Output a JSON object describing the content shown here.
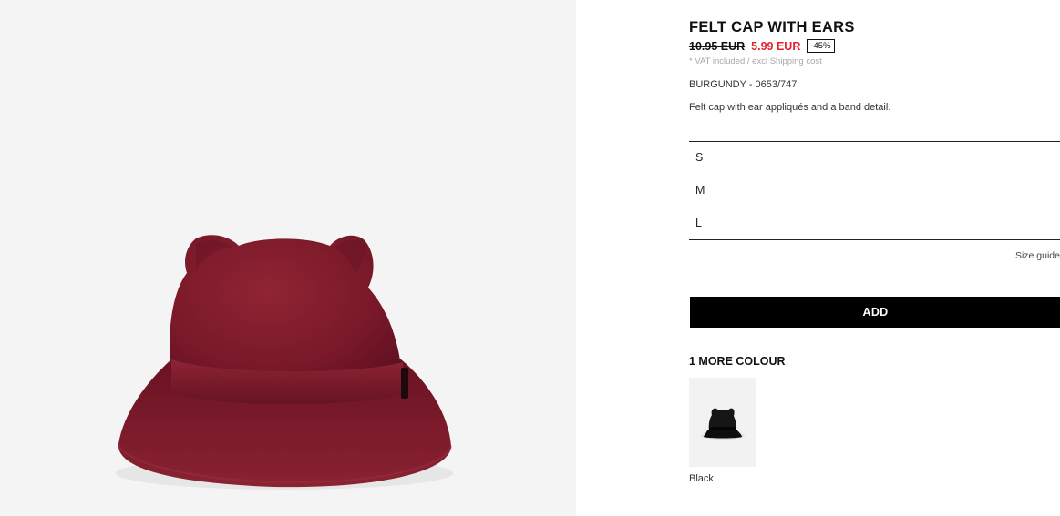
{
  "product": {
    "title": "FELT CAP WITH EARS",
    "old_price": "10.95 EUR",
    "new_price": "5.99 EUR",
    "discount": "-45%",
    "vat_note": "* VAT included / excl Shipping cost",
    "colour_code": "BURGUNDY - 0653/747",
    "description": "Felt cap with ear appliqués and a band detail.",
    "image_colour": "#7e1a2a"
  },
  "sizes": [
    {
      "label": "S"
    },
    {
      "label": "M"
    },
    {
      "label": "L"
    }
  ],
  "size_guide_label": "Size guide",
  "add_button_label": "ADD",
  "more_colours": {
    "heading": "1 MORE COLOUR",
    "items": [
      {
        "label": "Black",
        "colour": "#111111"
      }
    ]
  },
  "colors": {
    "sale_red": "#e5202e",
    "button_black": "#000000",
    "image_background": "#f4f4f4"
  }
}
